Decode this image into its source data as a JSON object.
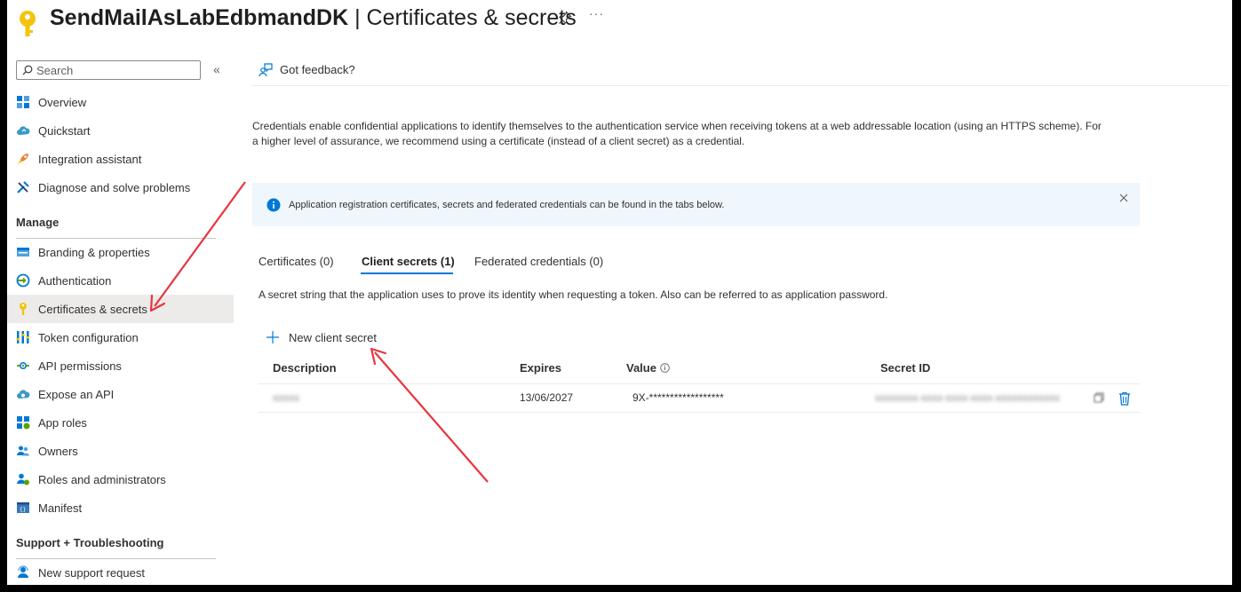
{
  "header": {
    "app_name": "SendMailAsLabEdbmandDK",
    "separator": " | ",
    "page_name": "Certificates & secrets",
    "more": "···"
  },
  "sidebar": {
    "search_placeholder": "Search",
    "collapse": "«",
    "top_items": [
      {
        "label": "Overview"
      },
      {
        "label": "Quickstart"
      },
      {
        "label": "Integration assistant"
      },
      {
        "label": "Diagnose and solve problems"
      }
    ],
    "manage_section": "Manage",
    "manage_items": [
      {
        "label": "Branding & properties"
      },
      {
        "label": "Authentication"
      },
      {
        "label": "Certificates & secrets"
      },
      {
        "label": "Token configuration"
      },
      {
        "label": "API permissions"
      },
      {
        "label": "Expose an API"
      },
      {
        "label": "App roles"
      },
      {
        "label": "Owners"
      },
      {
        "label": "Roles and administrators"
      },
      {
        "label": "Manifest"
      }
    ],
    "support_section": "Support + Troubleshooting",
    "support_items": [
      {
        "label": "New support request"
      }
    ],
    "active_item": "Certificates & secrets"
  },
  "toolbar": {
    "feedback_label": "Got feedback?"
  },
  "intro_text": "Credentials enable confidential applications to identify themselves to the authentication service when receiving tokens at a web addressable location (using an HTTPS scheme). For a higher level of assurance, we recommend using a certificate (instead of a client secret) as a credential.",
  "info_bar": {
    "text": "Application registration certificates, secrets and federated credentials can be found in the tabs below."
  },
  "tabs": [
    {
      "label": "Certificates (0)"
    },
    {
      "label": "Client secrets (1)",
      "selected": true
    },
    {
      "label": "Federated credentials (0)"
    }
  ],
  "client_secrets": {
    "description": "A secret string that the application uses to prove its identity when requesting a token. Also can be referred to as application password.",
    "new_button": "New client secret",
    "columns": [
      "Description",
      "Expires",
      "Value",
      "Secret ID"
    ],
    "rows": [
      {
        "description": "xxxxx",
        "expires": "13/06/2027",
        "value": "9X-******************",
        "secret_id": "xxxxxxxx-xxxx-xxxx-xxxx-xxxxxxxxxxxx"
      }
    ]
  },
  "colors": {
    "accent": "#0078d4",
    "annotation_arrow": "#e8353f",
    "key_icon": "#f2c40f",
    "info_bg": "#eff6fc"
  }
}
